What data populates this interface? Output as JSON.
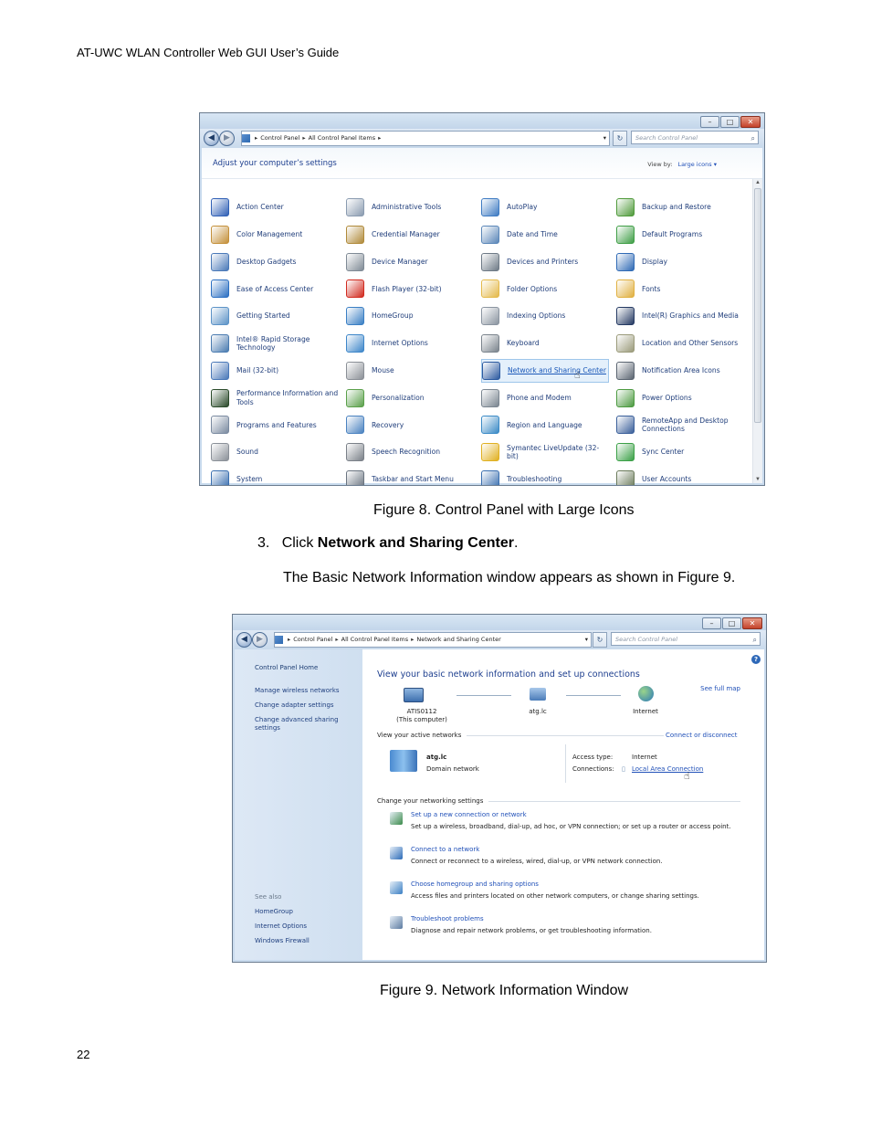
{
  "header_text": "AT-UWC WLAN Controller Web GUI User’s Guide",
  "page_number": "22",
  "fig8": {
    "breadcrumb": [
      "Control Panel",
      "All Control Panel Items"
    ],
    "search_placeholder": "Search Control Panel",
    "adjust_title": "Adjust your computer’s settings",
    "view_by_label": "View by:",
    "view_by_value": "Large icons ▾",
    "items": [
      {
        "label": "Action Center",
        "icon": "flag-icon",
        "color": "#2f5fb5"
      },
      {
        "label": "Administrative Tools",
        "icon": "admin-tools-icon",
        "color": "#8a9bb0"
      },
      {
        "label": "AutoPlay",
        "icon": "autoplay-icon",
        "color": "#3d7ac2"
      },
      {
        "label": "Backup and Restore",
        "icon": "backup-icon",
        "color": "#4f9a3a"
      },
      {
        "label": "Color Management",
        "icon": "color-icon",
        "color": "#c4903a"
      },
      {
        "label": "Credential Manager",
        "icon": "vault-icon",
        "color": "#b08a3a"
      },
      {
        "label": "Date and Time",
        "icon": "clock-icon",
        "color": "#5a86b8"
      },
      {
        "label": "Default Programs",
        "icon": "default-programs-icon",
        "color": "#3f9e46"
      },
      {
        "label": "Desktop Gadgets",
        "icon": "gadgets-icon",
        "color": "#4a79b8"
      },
      {
        "label": "Device Manager",
        "icon": "device-manager-icon",
        "color": "#7f8a95"
      },
      {
        "label": "Devices and Printers",
        "icon": "printer-icon",
        "color": "#6e7a86"
      },
      {
        "label": "Display",
        "icon": "display-icon",
        "color": "#2f6ab5"
      },
      {
        "label": "Ease of Access Center",
        "icon": "ease-access-icon",
        "color": "#2b6fc2"
      },
      {
        "label": "Flash Player (32-bit)",
        "icon": "flash-icon",
        "color": "#d12a1f"
      },
      {
        "label": "Folder Options",
        "icon": "folder-icon",
        "color": "#e4b94a"
      },
      {
        "label": "Fonts",
        "icon": "fonts-icon",
        "color": "#e0b040"
      },
      {
        "label": "Getting Started",
        "icon": "getting-started-icon",
        "color": "#5c93c7"
      },
      {
        "label": "HomeGroup",
        "icon": "homegroup-icon",
        "color": "#3a7fc4"
      },
      {
        "label": "Indexing Options",
        "icon": "indexing-icon",
        "color": "#8a94a0"
      },
      {
        "label": "Intel(R) Graphics and Media",
        "icon": "intel-graphics-icon",
        "color": "#253a63"
      },
      {
        "label": "Intel® Rapid Storage Technology",
        "icon": "intel-storage-icon",
        "color": "#4a7bb0"
      },
      {
        "label": "Internet Options",
        "icon": "internet-options-icon",
        "color": "#3d86c9"
      },
      {
        "label": "Keyboard",
        "icon": "keyboard-icon",
        "color": "#7a838c"
      },
      {
        "label": "Location and Other Sensors",
        "icon": "sensors-icon",
        "color": "#9a9a7a"
      },
      {
        "label": "Mail (32-bit)",
        "icon": "mail-icon",
        "color": "#4a78b8"
      },
      {
        "label": "Mouse",
        "icon": "mouse-icon",
        "color": "#8a8f96"
      },
      {
        "label": "Network and Sharing Center",
        "icon": "network-icon",
        "color": "#2c5aa0"
      },
      {
        "label": "Notification Area Icons",
        "icon": "notification-icon",
        "color": "#5a6470"
      },
      {
        "label": "Performance Information and Tools",
        "icon": "performance-icon",
        "color": "#2a4a2a"
      },
      {
        "label": "Personalization",
        "icon": "personalization-icon",
        "color": "#5aa04a"
      },
      {
        "label": "Phone and Modem",
        "icon": "phone-icon",
        "color": "#7a8590"
      },
      {
        "label": "Power Options",
        "icon": "power-icon",
        "color": "#4c9a40"
      },
      {
        "label": "Programs and Features",
        "icon": "programs-icon",
        "color": "#7a8aa0"
      },
      {
        "label": "Recovery",
        "icon": "recovery-icon",
        "color": "#4a82c0"
      },
      {
        "label": "Region and Language",
        "icon": "region-icon",
        "color": "#3a8ac6"
      },
      {
        "label": "RemoteApp and Desktop Connections",
        "icon": "remoteapp-icon",
        "color": "#3a5f9a"
      },
      {
        "label": "Sound",
        "icon": "sound-icon",
        "color": "#8a9098"
      },
      {
        "label": "Speech Recognition",
        "icon": "microphone-icon",
        "color": "#7a8088"
      },
      {
        "label": "Symantec LiveUpdate (32-bit)",
        "icon": "liveupdate-icon",
        "color": "#e0b020"
      },
      {
        "label": "Sync Center",
        "icon": "sync-icon",
        "color": "#3aa046"
      },
      {
        "label": "System",
        "icon": "system-icon",
        "color": "#3a6fb0"
      },
      {
        "label": "Taskbar and Start Menu",
        "icon": "taskbar-icon",
        "color": "#6a7480"
      },
      {
        "label": "Troubleshooting",
        "icon": "troubleshooting-icon",
        "color": "#3a6fb0"
      },
      {
        "label": "User Accounts",
        "icon": "user-accounts-icon",
        "color": "#6a7a5a"
      }
    ],
    "caption": "Figure 8. Control Panel with Large Icons"
  },
  "step": {
    "number": "3.",
    "prefix": "Click ",
    "bold": "Network and Sharing Center",
    "suffix": "."
  },
  "paragraph": "The Basic Network Information window appears as shown in Figure 9.",
  "fig9": {
    "breadcrumb": [
      "Control Panel",
      "All Control Panel Items",
      "Network and Sharing Center"
    ],
    "search_placeholder": "Search Control Panel",
    "sidebar": {
      "home": "Control Panel Home",
      "links": [
        "Manage wireless networks",
        "Change adapter settings",
        "Change advanced sharing settings"
      ],
      "see_also": "See also",
      "see_also_links": [
        "HomeGroup",
        "Internet Options",
        "Windows Firewall"
      ]
    },
    "title": "View your basic network information and set up connections",
    "see_full_map": "See full map",
    "nodes": {
      "computer": "ATIS0112",
      "computer_sub": "(This computer)",
      "network": "atg.lc",
      "internet": "Internet"
    },
    "active_networks_label": "View your active networks",
    "connect_disconnect": "Connect or disconnect",
    "network_name": "atg.lc",
    "network_type": "Domain network",
    "access_type_label": "Access type:",
    "access_type_value": "Internet",
    "connections_label": "Connections:",
    "connections_value": "Local Area Connection",
    "change_settings_label": "Change your networking settings",
    "tasks": [
      {
        "link": "Set up a new connection or network",
        "desc": "Set up a wireless, broadband, dial-up, ad hoc, or VPN connection; or set up a router or access point.",
        "icon": "new-connection-icon"
      },
      {
        "link": "Connect to a network",
        "desc": "Connect or reconnect to a wireless, wired, dial-up, or VPN network connection.",
        "icon": "connect-network-icon"
      },
      {
        "link": "Choose homegroup and sharing options",
        "desc": "Access files and printers located on other network computers, or change sharing settings.",
        "icon": "homegroup-icon"
      },
      {
        "link": "Troubleshoot problems",
        "desc": "Diagnose and repair network problems, or get troubleshooting information.",
        "icon": "troubleshoot-icon"
      }
    ],
    "caption": "Figure 9. Network Information Window"
  }
}
